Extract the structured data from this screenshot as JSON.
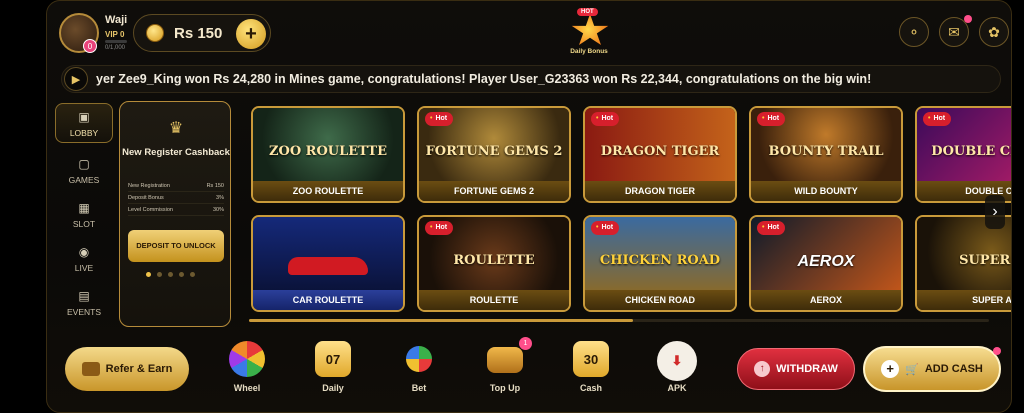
{
  "header": {
    "username": "Waji",
    "vip_label": "VIP 0",
    "vip_progress": "0/1,000",
    "avatar_badge": "0",
    "balance": "Rs 150",
    "daily_bonus_badge": "HOT",
    "daily_bonus_label": "Daily Bonus"
  },
  "marquee": {
    "text": "yer Zee9_King won Rs 24,280 in Mines game, congratulations! Player User_G23363 won Rs 22,344, congratulations on the big win!"
  },
  "sidebar": {
    "items": [
      {
        "label": "LOBBY",
        "icon": "lobby-icon"
      },
      {
        "label": "GAMES",
        "icon": "games-icon"
      },
      {
        "label": "SLOT",
        "icon": "slot-icon"
      },
      {
        "label": "LIVE",
        "icon": "live-icon"
      },
      {
        "label": "EVENTS",
        "icon": "events-icon"
      }
    ]
  },
  "cashback": {
    "title": "New Register Cashback",
    "rows": [
      {
        "k": "New Registration",
        "v": "Rs 150"
      },
      {
        "k": "Deposit Bonus",
        "v": "3%"
      },
      {
        "k": "Level Commission",
        "v": "30%"
      }
    ],
    "button": "DEPOSIT TO UNLOCK"
  },
  "games": [
    {
      "name": "ZOO ROULETTE",
      "logo": "ZOO ROULETTE",
      "hot": false
    },
    {
      "name": "FORTUNE GEMS 2",
      "logo": "FORTUNE GEMS 2",
      "hot": true
    },
    {
      "name": "DRAGON TIGER",
      "logo": "DRAGON TIGER",
      "hot": true
    },
    {
      "name": "WILD BOUNTY",
      "logo": "BOUNTY TRAIL",
      "hot": true
    },
    {
      "name": "DOUBLE CR",
      "logo": "DOUBLE CRASH",
      "hot": true
    },
    {
      "name": "CAR ROULETTE",
      "logo": "",
      "hot": false
    },
    {
      "name": "ROULETTE",
      "logo": "ROULETTE",
      "hot": true
    },
    {
      "name": "CHICKEN ROAD",
      "logo": "CHICKEN ROAD",
      "hot": true
    },
    {
      "name": "AEROX",
      "logo": "AEROX",
      "hot": true
    },
    {
      "name": "SUPER A",
      "logo": "SUPER A",
      "hot": false
    }
  ],
  "hot_label": "Hot",
  "bottom": {
    "refer": "Refer & Earn",
    "items": [
      {
        "label": "Wheel"
      },
      {
        "label": "Daily",
        "value": "07"
      },
      {
        "label": "Bet"
      },
      {
        "label": "Top Up",
        "badge": "1"
      },
      {
        "label": "Cash",
        "value": "30"
      },
      {
        "label": "APK"
      }
    ],
    "withdraw": "WITHDRAW",
    "add_cash": "ADD CASH"
  },
  "colors": {
    "gold": "#c99a3a",
    "hot_red": "#d71f2c",
    "withdraw_red": "#e0303f"
  }
}
